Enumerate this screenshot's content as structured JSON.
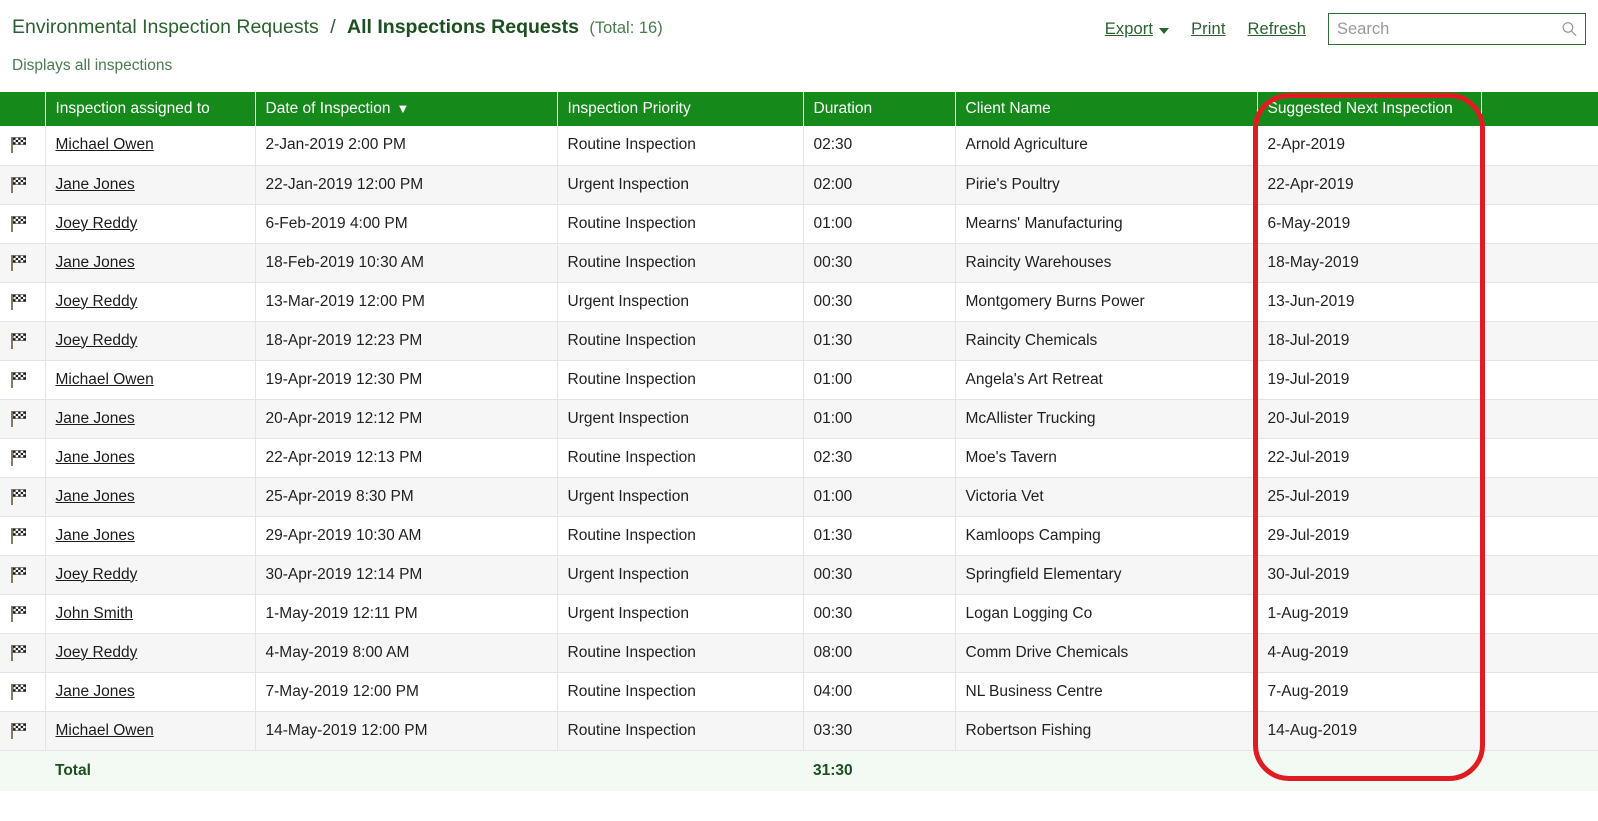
{
  "header": {
    "breadcrumb_root": "Environmental Inspection Requests",
    "breadcrumb_separator": "/",
    "breadcrumb_current": "All Inspections Requests",
    "total_label": "(Total: 16)",
    "subtitle": "Displays all inspections"
  },
  "toolbar": {
    "export_label": "Export",
    "print_label": "Print",
    "refresh_label": "Refresh",
    "search_placeholder": "Search",
    "search_value": ""
  },
  "table": {
    "columns": [
      "",
      "Inspection assigned to",
      "Date of Inspection",
      "Inspection Priority",
      "Duration",
      "Client Name",
      "Suggested Next Inspection",
      ""
    ],
    "sort_column": "Date of Inspection",
    "sort_direction_glyph": "▼",
    "rows": [
      {
        "assigned_to": "Michael Owen",
        "date": "2-Jan-2019 2:00 PM",
        "priority": "Routine Inspection",
        "duration": "02:30",
        "client": "Arnold Agriculture",
        "next": "2-Apr-2019"
      },
      {
        "assigned_to": "Jane Jones",
        "date": "22-Jan-2019 12:00 PM",
        "priority": "Urgent Inspection",
        "duration": "02:00",
        "client": "Pirie's Poultry",
        "next": "22-Apr-2019"
      },
      {
        "assigned_to": "Joey Reddy",
        "date": "6-Feb-2019 4:00 PM",
        "priority": "Routine Inspection",
        "duration": "01:00",
        "client": "Mearns' Manufacturing",
        "next": "6-May-2019"
      },
      {
        "assigned_to": "Jane Jones",
        "date": "18-Feb-2019 10:30 AM",
        "priority": "Routine Inspection",
        "duration": "00:30",
        "client": "Raincity Warehouses",
        "next": "18-May-2019"
      },
      {
        "assigned_to": "Joey Reddy",
        "date": "13-Mar-2019 12:00 PM",
        "priority": "Urgent Inspection",
        "duration": "00:30",
        "client": "Montgomery Burns Power",
        "next": "13-Jun-2019"
      },
      {
        "assigned_to": "Joey Reddy",
        "date": "18-Apr-2019 12:23 PM",
        "priority": "Routine Inspection",
        "duration": "01:30",
        "client": "Raincity Chemicals",
        "next": "18-Jul-2019"
      },
      {
        "assigned_to": "Michael Owen",
        "date": "19-Apr-2019 12:30 PM",
        "priority": "Routine Inspection",
        "duration": "01:00",
        "client": "Angela's Art Retreat",
        "next": "19-Jul-2019"
      },
      {
        "assigned_to": "Jane Jones",
        "date": "20-Apr-2019 12:12 PM",
        "priority": "Urgent Inspection",
        "duration": "01:00",
        "client": "McAllister Trucking",
        "next": "20-Jul-2019"
      },
      {
        "assigned_to": "Jane Jones",
        "date": "22-Apr-2019 12:13 PM",
        "priority": "Routine Inspection",
        "duration": "02:30",
        "client": "Moe's Tavern",
        "next": "22-Jul-2019"
      },
      {
        "assigned_to": "Jane Jones",
        "date": "25-Apr-2019 8:30 PM",
        "priority": "Urgent Inspection",
        "duration": "01:00",
        "client": "Victoria Vet",
        "next": "25-Jul-2019"
      },
      {
        "assigned_to": "Jane Jones",
        "date": "29-Apr-2019 10:30 AM",
        "priority": "Routine Inspection",
        "duration": "01:30",
        "client": "Kamloops Camping",
        "next": "29-Jul-2019"
      },
      {
        "assigned_to": "Joey Reddy",
        "date": "30-Apr-2019 12:14 PM",
        "priority": "Urgent Inspection",
        "duration": "00:30",
        "client": "Springfield Elementary",
        "next": "30-Jul-2019"
      },
      {
        "assigned_to": "John Smith",
        "date": "1-May-2019 12:11 PM",
        "priority": "Urgent Inspection",
        "duration": "00:30",
        "client": "Logan Logging Co",
        "next": "1-Aug-2019"
      },
      {
        "assigned_to": "Joey Reddy",
        "date": "4-May-2019 8:00 AM",
        "priority": "Routine Inspection",
        "duration": "08:00",
        "client": "Comm Drive Chemicals",
        "next": "4-Aug-2019"
      },
      {
        "assigned_to": "Jane Jones",
        "date": "7-May-2019 12:00 PM",
        "priority": "Routine Inspection",
        "duration": "04:00",
        "client": "NL Business Centre",
        "next": "7-Aug-2019"
      },
      {
        "assigned_to": "Michael Owen",
        "date": "14-May-2019 12:00 PM",
        "priority": "Routine Inspection",
        "duration": "03:30",
        "client": "Robertson Fishing",
        "next": "14-Aug-2019"
      }
    ],
    "footer": {
      "label": "Total",
      "duration_total": "31:30"
    }
  },
  "icons": {
    "row_icon": "checkered-flag-icon",
    "search_icon": "search-icon",
    "export_caret": "chevron-down-icon"
  },
  "annotation": {
    "shape": "rounded-rectangle",
    "color": "#e01b22",
    "target_column": "Suggested Next Inspection"
  },
  "colors": {
    "header_green": "#158a1b",
    "link_green": "#2b6130",
    "annotation_red": "#e01b22",
    "row_alt": "#f6f6f6",
    "footer_bg": "#f3faf3"
  }
}
